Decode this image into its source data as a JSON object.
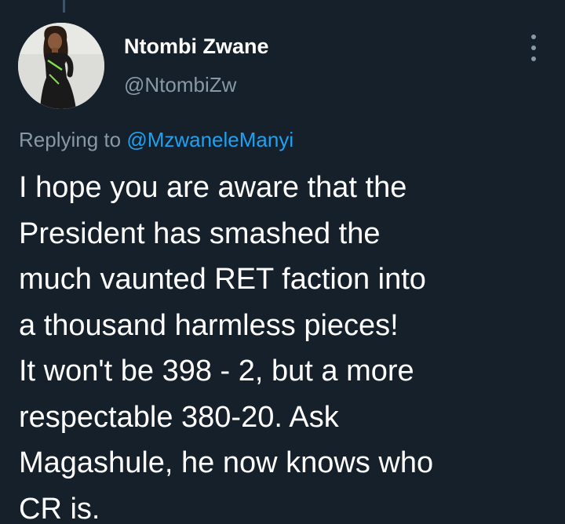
{
  "tweet": {
    "author": {
      "display_name": "Ntombi Zwane",
      "handle": "@NtombiZw",
      "avatar_icon": "profile-photo"
    },
    "more_menu_icon": "more-vertical-icon",
    "replying_to": {
      "prefix": "Replying to",
      "mention": "@MzwaneleManyi"
    },
    "text_lines": [
      "I hope you are aware that the",
      "President has smashed the",
      "much vaunted RET faction into",
      "a thousand harmless pieces!",
      "It won't be 398 - 2, but a more",
      "respectable 380-20. Ask",
      "Magashule, he now knows who",
      "CR is."
    ]
  },
  "colors": {
    "background": "#15202b",
    "primary_text": "#ffffff",
    "secondary_text": "#8899a6",
    "link": "#1da1f2",
    "thread_line": "#3d5466"
  }
}
